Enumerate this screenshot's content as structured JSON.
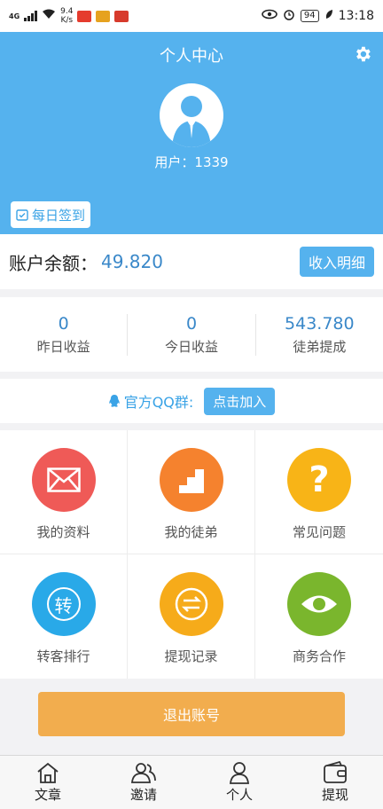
{
  "status_bar": {
    "signal": "4G",
    "speed_value": "9.4",
    "speed_unit": "K/s",
    "battery": "94",
    "time": "13:18"
  },
  "header": {
    "title": "个人中心",
    "username": "用户：1339",
    "checkin_label": "每日签到"
  },
  "balance": {
    "label": "账户余额：",
    "value": "49.820",
    "detail_button": "收入明细"
  },
  "stats": [
    {
      "value": "0",
      "label": "昨日收益"
    },
    {
      "value": "0",
      "label": "今日收益"
    },
    {
      "value": "543.780",
      "label": "徒弟提成"
    }
  ],
  "qq": {
    "label": "官方QQ群:",
    "join_button": "点击加入"
  },
  "grid": [
    {
      "label": "我的资料",
      "icon": "mail-icon",
      "color": "#ef5a57"
    },
    {
      "label": "我的徒弟",
      "icon": "stairs-icon",
      "color": "#f5822e"
    },
    {
      "label": "常见问题",
      "icon": "question-icon",
      "color": "#f8b417"
    },
    {
      "label": "转客排行",
      "icon": "zhuan-icon",
      "color": "#29a9e8"
    },
    {
      "label": "提现记录",
      "icon": "exchange-icon",
      "color": "#f6ab1a"
    },
    {
      "label": "商务合作",
      "icon": "eye-icon",
      "color": "#7ab62d"
    }
  ],
  "grid_texts": {
    "zhuan_glyph": "转",
    "question_glyph": "?"
  },
  "logout_label": "退出账号",
  "bottom_nav": [
    {
      "label": "文章",
      "icon": "home-icon"
    },
    {
      "label": "邀请",
      "icon": "people-icon"
    },
    {
      "label": "个人",
      "icon": "person-icon"
    },
    {
      "label": "提现",
      "icon": "wallet-icon"
    }
  ],
  "colors": {
    "primary": "#55b2ee",
    "value_blue": "#3a88c9",
    "logout": "#f2ad4e"
  }
}
